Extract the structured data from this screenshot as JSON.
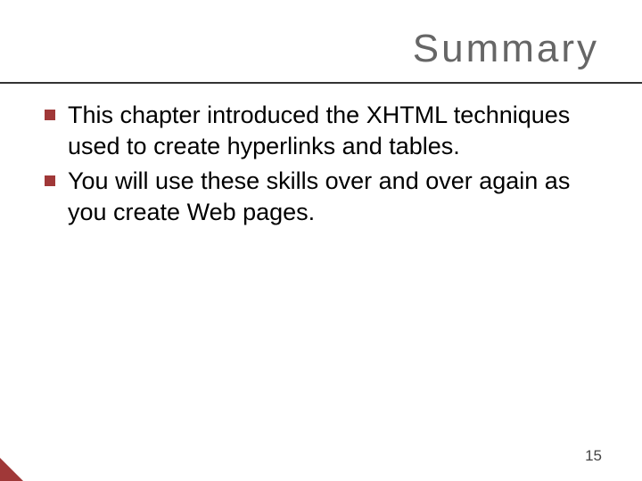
{
  "slide": {
    "title": "Summary",
    "bullets": [
      "This chapter introduced the XHTML techniques used to create hyperlinks and tables.",
      "You will use these skills over and over again as you create Web pages."
    ],
    "page_number": "15"
  },
  "colors": {
    "accent": "#a03838",
    "bullet": "#a03838",
    "title": "#666666"
  }
}
